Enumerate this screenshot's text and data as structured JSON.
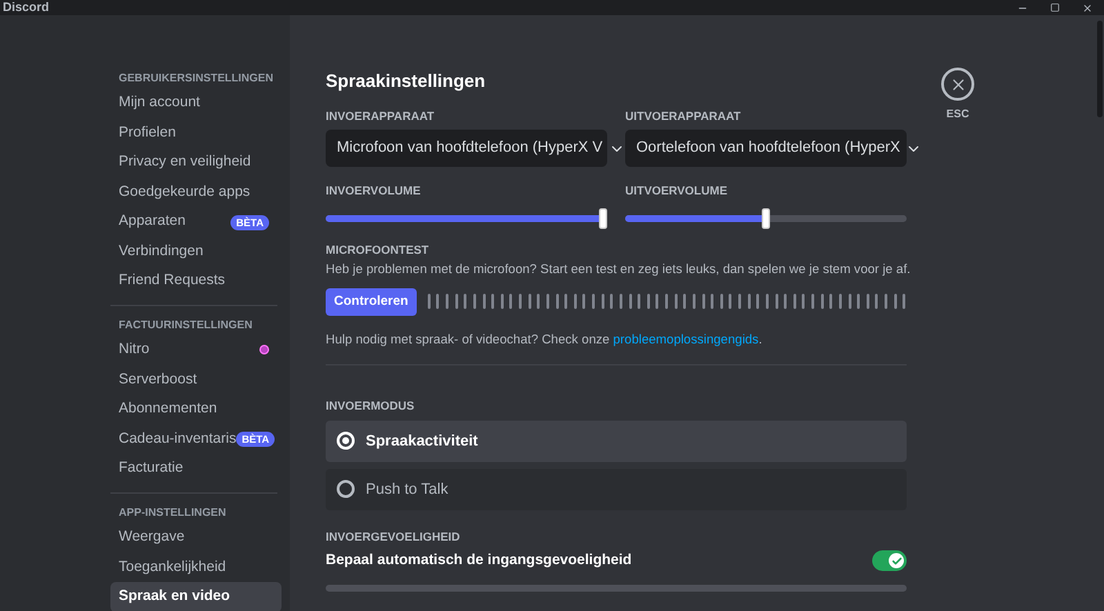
{
  "window": {
    "title": "Discord"
  },
  "sidebar": {
    "sections": [
      {
        "header": "GEBRUIKERSINSTELLINGEN",
        "items": [
          {
            "label": "Mijn account",
            "selected": false
          },
          {
            "label": "Profielen",
            "selected": false
          },
          {
            "label": "Privacy en veiligheid",
            "selected": false
          },
          {
            "label": "Goedgekeurde apps",
            "selected": false
          },
          {
            "label": "Apparaten",
            "selected": false,
            "badge": "BÈTA"
          },
          {
            "label": "Verbindingen",
            "selected": false
          },
          {
            "label": "Friend Requests",
            "selected": false
          }
        ]
      },
      {
        "header": "FACTUURINSTELLINGEN",
        "items": [
          {
            "label": "Nitro",
            "selected": false,
            "icon": true
          },
          {
            "label": "Serverboost",
            "selected": false
          },
          {
            "label": "Abonnementen",
            "selected": false
          },
          {
            "label": "Cadeau-inventaris",
            "selected": false,
            "badge": "BÈTA"
          },
          {
            "label": "Facturatie",
            "selected": false
          }
        ]
      },
      {
        "header": "APP-INSTELLINGEN",
        "items": [
          {
            "label": "Weergave",
            "selected": false
          },
          {
            "label": "Toegankelijkheid",
            "selected": false
          },
          {
            "label": "Spraak en video",
            "selected": true
          }
        ]
      }
    ]
  },
  "content": {
    "title": "Spraakinstellingen",
    "devices": [
      {
        "label": "INVOERAPPARAAT",
        "value": "Microfoon van hoofdtelefoon (HyperX V"
      },
      {
        "label": "UITVOERAPPARAAT",
        "value": "Oortelefoon van hoofdtelefoon (HyperX"
      }
    ],
    "volumes": [
      {
        "label": "INVOERVOLUME",
        "level": 1.0
      },
      {
        "label": "UITVOERVOLUME",
        "level": 0.5
      }
    ],
    "mic_test": {
      "header": "MICROFOONTEST",
      "description": "Heb je problemen met de microfoon? Start een test en zeg iets leuks, dan spelen we je stem voor je af.",
      "button": "Controleren"
    },
    "help": {
      "text": "Hulp nodig met spraak- of videochat? Check onze ",
      "link": "probleemoplossingengids",
      "suffix": "."
    },
    "input_mode": {
      "header": "INVOERMODUS",
      "options": [
        {
          "label": "Spraakactiviteit",
          "selected": true
        },
        {
          "label": "Push to Talk",
          "selected": false
        }
      ]
    },
    "sensitivity": {
      "header": "INVOERGEVOELIGHEID",
      "label": "Bepaal automatisch de ingangsgevoeligheid",
      "on": true
    },
    "close": {
      "label": "ESC"
    }
  }
}
